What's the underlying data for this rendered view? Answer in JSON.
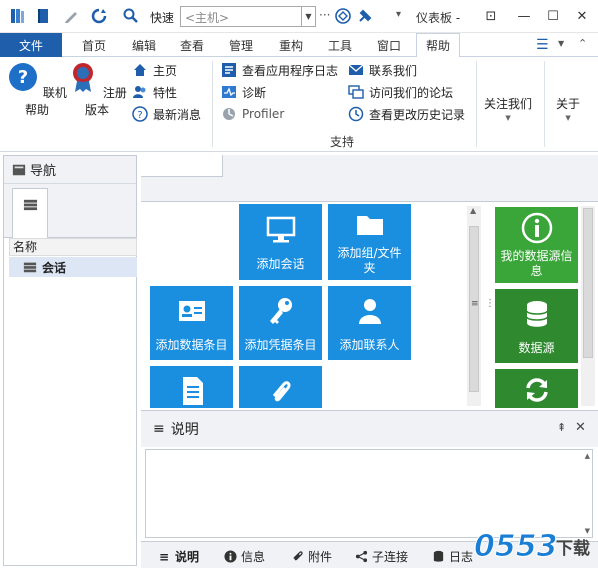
{
  "titlebar": {
    "quick_search_label": "快速",
    "host_placeholder": "<主机>",
    "more_label": "···",
    "window_title": "仪表板 -",
    "accent": "#1e5eaa"
  },
  "ribbon_tabs": [
    {
      "label": "文件"
    },
    {
      "label": "首页"
    },
    {
      "label": "编辑"
    },
    {
      "label": "查看"
    },
    {
      "label": "管理"
    },
    {
      "label": "重构"
    },
    {
      "label": "工具"
    },
    {
      "label": "窗口"
    },
    {
      "label": "帮助"
    }
  ],
  "ribbon": {
    "online_help": "联机帮助",
    "register": "注册版本",
    "home": "主页",
    "features": "特性",
    "latest_news": "最新消息",
    "view_log": "查看应用程序日志",
    "diagnose": "诊断",
    "profiler": "Profiler",
    "contact": "联系我们",
    "forum": "访问我们的论坛",
    "changelog": "查看更改历史记录",
    "support_group": "支持",
    "follow_us": "关注我们",
    "about": "关于"
  },
  "nav": {
    "title": "导航",
    "column_name": "名称",
    "session": "会话"
  },
  "tiles": {
    "add_session": "添加会话",
    "add_group": "添加组/文件夹",
    "add_data_entry": "添加数据条目",
    "add_credential": "添加凭据条目",
    "add_contact": "添加联系人",
    "my_datasource_info": "我的数据源信息",
    "datasource": "数据源",
    "colors": {
      "blue": "#1a8fe0",
      "green": "#3aa63a",
      "dark_green": "#2f8a2f"
    }
  },
  "description": {
    "title": "说明",
    "tabs": [
      {
        "label": "说明"
      },
      {
        "label": "信息"
      },
      {
        "label": "附件"
      },
      {
        "label": "子连接"
      },
      {
        "label": "日志"
      }
    ]
  },
  "watermark": {
    "text": "0553 下载"
  }
}
